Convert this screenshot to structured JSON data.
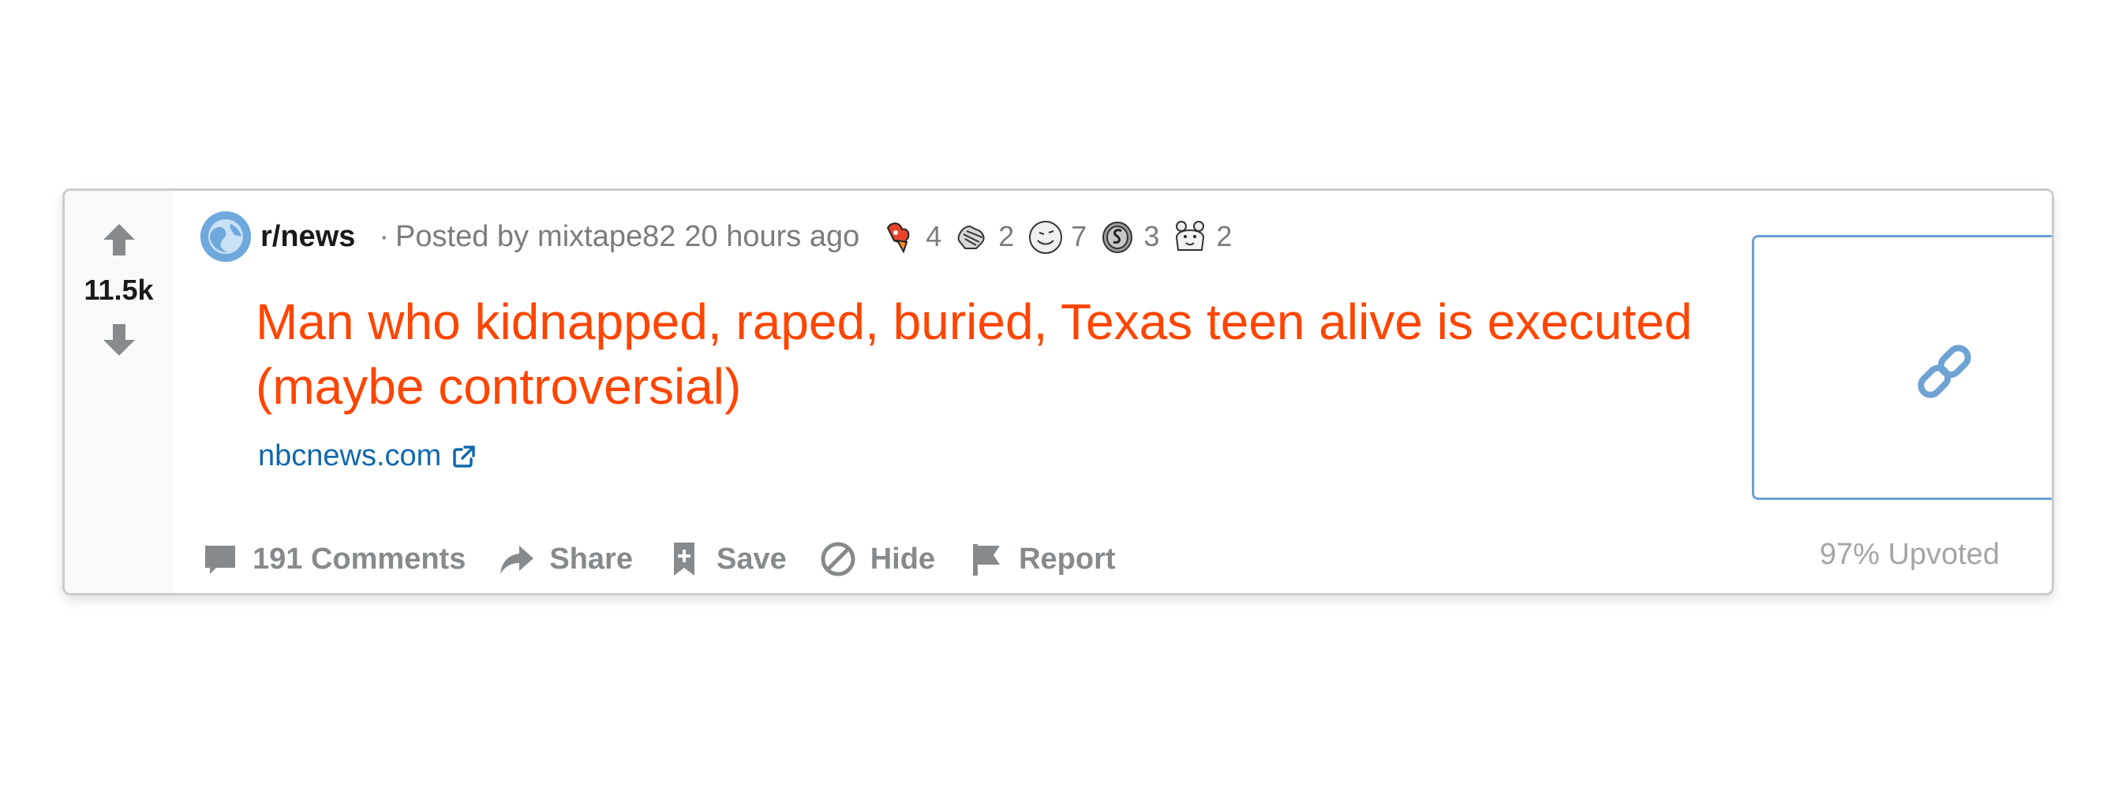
{
  "post": {
    "vote_count": "11.5k",
    "subreddit": "r/news",
    "meta_dot": "·",
    "posted_by_label": "Posted by",
    "author": "mixtape82",
    "time": "20 hours ago",
    "awards": [
      {
        "icon": "rocket-like-award-icon",
        "count": "4"
      },
      {
        "icon": "hands-award-icon",
        "count": "2"
      },
      {
        "icon": "face-award-icon",
        "count": "7"
      },
      {
        "icon": "silver-coin-award-icon",
        "count": "3"
      },
      {
        "icon": "bear-award-icon",
        "count": "2"
      }
    ],
    "title": "Man who kidnapped, raped, buried, Texas teen alive is executed (maybe controversial)",
    "domain": "nbcnews.com",
    "upvoted_ratio": "97% Upvoted"
  },
  "actions": {
    "comments_count": "191",
    "comments_label": "Comments",
    "share": "Share",
    "save": "Save",
    "hide": "Hide",
    "report": "Report"
  },
  "colors": {
    "title": "#ff4500",
    "domain": "#1168ae",
    "meta": "#7c7c7c",
    "action": "#878a8c",
    "thumb_border": "#6aa0d4",
    "thumb_button": "#5a95c8"
  }
}
